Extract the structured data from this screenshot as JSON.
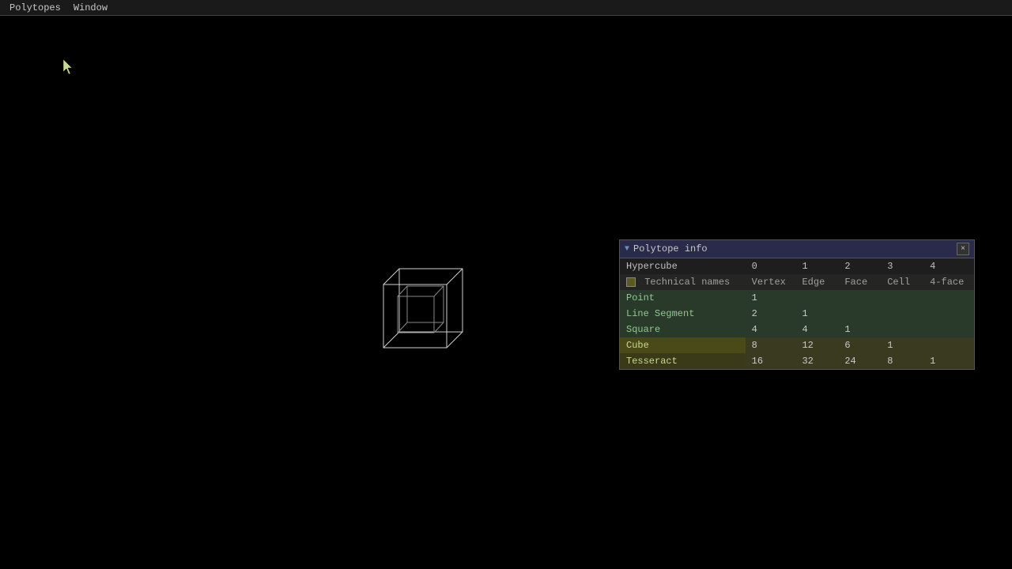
{
  "menubar": {
    "items": [
      {
        "id": "polytopes",
        "label": "Polytopes"
      },
      {
        "id": "window",
        "label": "Window"
      }
    ]
  },
  "panel": {
    "title": "Polytope info",
    "close_label": "×",
    "table": {
      "headers": {
        "hypercube": "Hypercube",
        "col0": "0",
        "col1": "1",
        "col2": "2",
        "col3": "3",
        "col4": "4"
      },
      "tech_names": {
        "label": "Technical names",
        "col0": "Vertex",
        "col1": "Edge",
        "col2": "Face",
        "col3": "Cell",
        "col4": "4-face"
      },
      "rows": [
        {
          "name": "Point",
          "values": [
            "1",
            "",
            "",
            "",
            ""
          ]
        },
        {
          "name": "Line Segment",
          "values": [
            "2",
            "1",
            "",
            "",
            ""
          ]
        },
        {
          "name": "Square",
          "values": [
            "4",
            "4",
            "1",
            "",
            ""
          ]
        },
        {
          "name": "Cube",
          "values": [
            "8",
            "12",
            "6",
            "1",
            ""
          ]
        },
        {
          "name": "Tesseract",
          "values": [
            "16",
            "32",
            "24",
            "8",
            "1"
          ]
        }
      ]
    }
  }
}
